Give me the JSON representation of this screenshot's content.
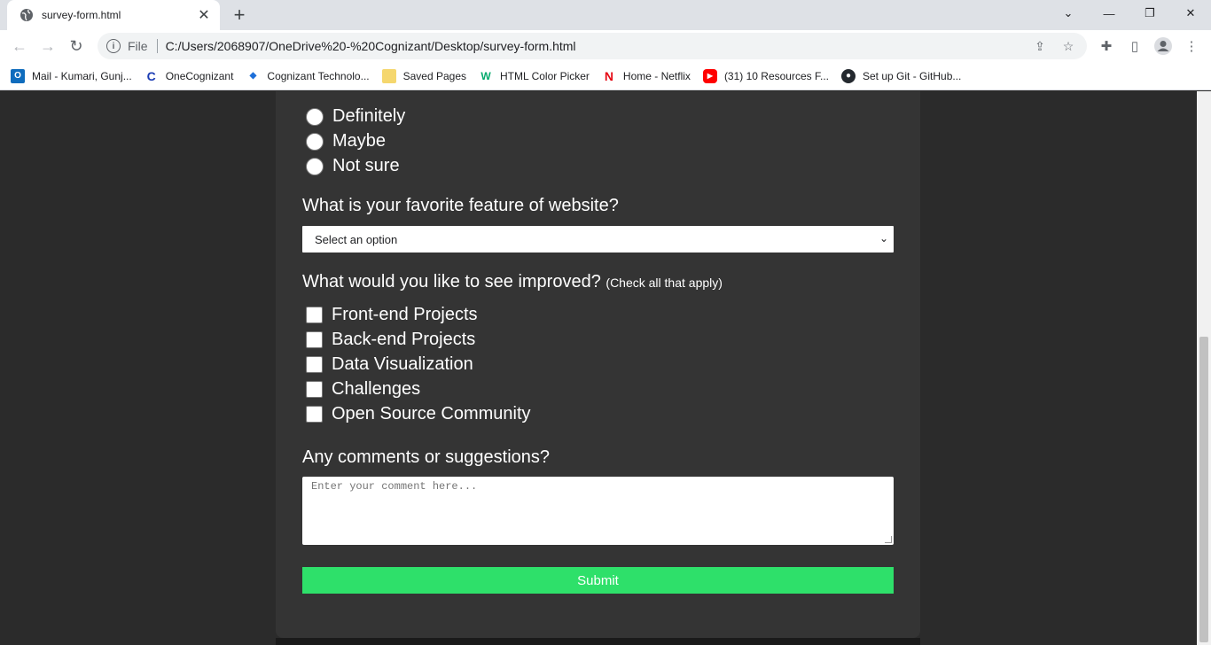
{
  "browser": {
    "tab_title": "survey-form.html",
    "url_scheme": "File",
    "url": "C:/Users/2068907/OneDrive%20-%20Cognizant/Desktop/survey-form.html",
    "bookmarks": [
      {
        "label": "Mail - Kumari, Gunj...",
        "icon": "outlook-icon",
        "color": "#0f6cbd"
      },
      {
        "label": "OneCognizant",
        "icon": "onecognizant-icon",
        "color": "#1a3bb3"
      },
      {
        "label": "Cognizant Technolo...",
        "icon": "cognizant-icon",
        "color": "#1e6fd9"
      },
      {
        "label": "Saved Pages",
        "icon": "folder-icon",
        "color": "#f5d76e"
      },
      {
        "label": "HTML Color Picker",
        "icon": "w3schools-icon",
        "color": "#04aa6d"
      },
      {
        "label": "Home - Netflix",
        "icon": "netflix-icon",
        "color": "#e50914"
      },
      {
        "label": "(31) 10 Resources F...",
        "icon": "youtube-icon",
        "color": "#ff0000"
      },
      {
        "label": "Set up Git - GitHub...",
        "icon": "github-icon",
        "color": "#24292f"
      }
    ]
  },
  "form": {
    "recommend_options": [
      "Definitely",
      "Maybe",
      "Not sure"
    ],
    "favorite_question": "What is your favorite feature of website?",
    "favorite_select_value": "Select an option",
    "improve_question": "What would you like to see improved?",
    "improve_hint": "(Check all that apply)",
    "improve_options": [
      "Front-end Projects",
      "Back-end Projects",
      "Data Visualization",
      "Challenges",
      "Open Source Community"
    ],
    "comments_question": "Any comments or suggestions?",
    "comments_placeholder": "Enter your comment here...",
    "submit_label": "Submit"
  },
  "colors": {
    "page_bg": "#2b2b2b",
    "card_bg": "#343434",
    "submit_bg": "#2ee06a"
  }
}
